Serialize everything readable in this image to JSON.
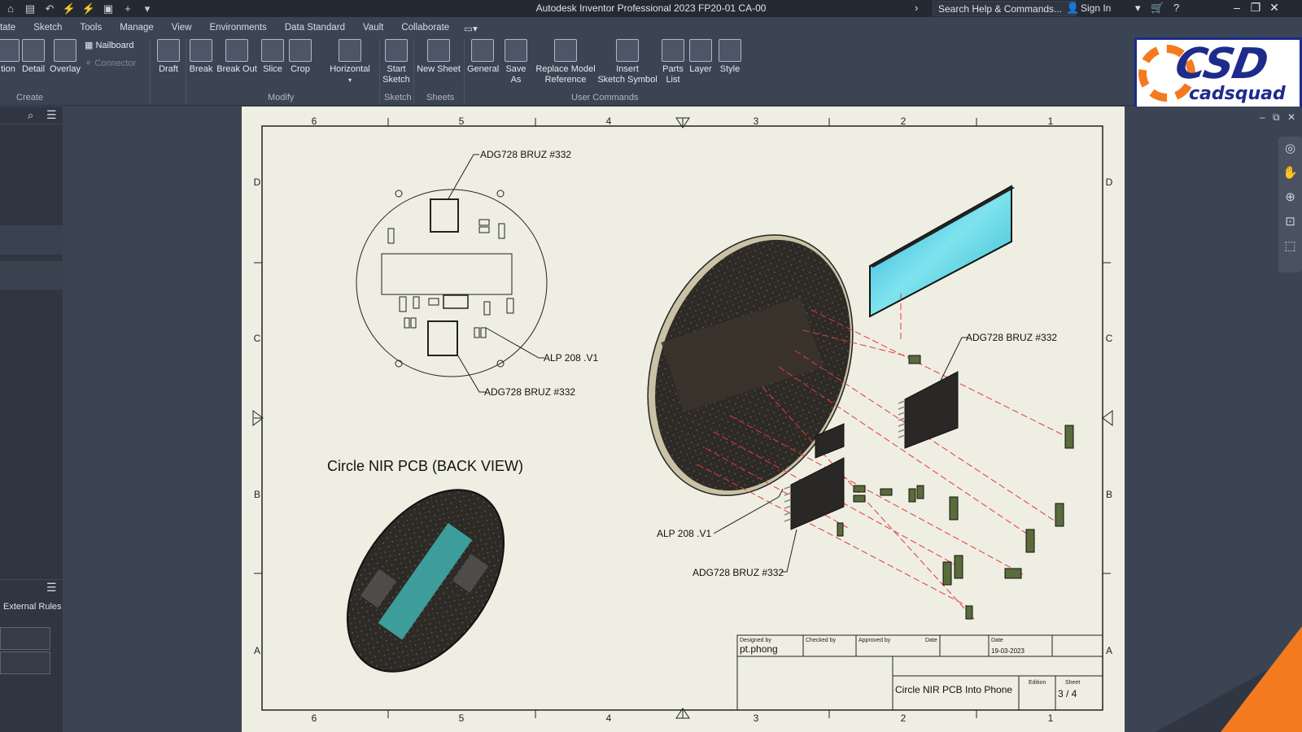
{
  "titlebar": {
    "app_title": "Autodesk Inventor Professional 2023   FP20-01 CA-00",
    "search_placeholder": "Search Help & Commands...",
    "sign_in": "Sign In"
  },
  "menu": [
    "tate",
    "Sketch",
    "Tools",
    "Manage",
    "View",
    "Environments",
    "Data Standard",
    "Vault",
    "Collaborate"
  ],
  "ribbon": {
    "create": {
      "group": "Create",
      "buttons": [
        "tion",
        "Detail",
        "Overlay"
      ],
      "small": [
        "Nailboard",
        "Connector"
      ]
    },
    "modify": {
      "group": "Modify",
      "buttons": [
        "Draft",
        "Break",
        "Break Out",
        "Slice",
        "Crop"
      ],
      "horizontal": "Horizontal"
    },
    "sketch": {
      "group": "Sketch",
      "start_line1": "Start",
      "start_line2": "Sketch"
    },
    "sheets": {
      "group": "Sheets",
      "new_sheet": "New Sheet"
    },
    "user_commands": {
      "group": "User Commands",
      "general": "General",
      "save_as": "Save As",
      "replace_line1": "Replace Model",
      "replace_line2": "Reference",
      "insert_line1": "Insert",
      "insert_line2": "Sketch Symbol",
      "parts_line1": "Parts",
      "parts_line2": "List",
      "layer": "Layer",
      "style": "Style"
    }
  },
  "logo": {
    "main": "CSD",
    "sub": "cadsquad"
  },
  "left_panel": {
    "external_rules": "External Rules"
  },
  "drawing": {
    "top_zones": [
      "6",
      "5",
      "4",
      "3",
      "2",
      "1"
    ],
    "side_zones": [
      "D",
      "C",
      "B",
      "A"
    ],
    "callouts": {
      "top_adg": "ADG728 BRUZ #332",
      "alp_left": "ALP 208 .V1",
      "mid_adg": "ADG728 BRUZ #332",
      "right_adg": "ADG728 BRUZ #332",
      "alp_right": "ALP 208 .V1",
      "bottom_adg": "ADG728 BRUZ #332"
    },
    "back_view_title": "Circle NIR PCB (BACK VIEW)",
    "title_block": {
      "designed_by_label": "Designed by",
      "designed_by": "pt.phong",
      "checked_by_label": "Checked by",
      "approved_by_label": "Approved by",
      "date_label": "Date",
      "date_label2": "Date",
      "date": "19-03-2023",
      "title": "Circle NIR PCB Into Phone",
      "edition_label": "Edition",
      "sheet_label": "Sheet",
      "sheet": "3 / 4"
    }
  },
  "colors": {
    "accent_orange": "#f47a20",
    "brand_blue": "#1d2b8c",
    "sheet": "#efeee3",
    "ui_bg": "#3b4453"
  }
}
